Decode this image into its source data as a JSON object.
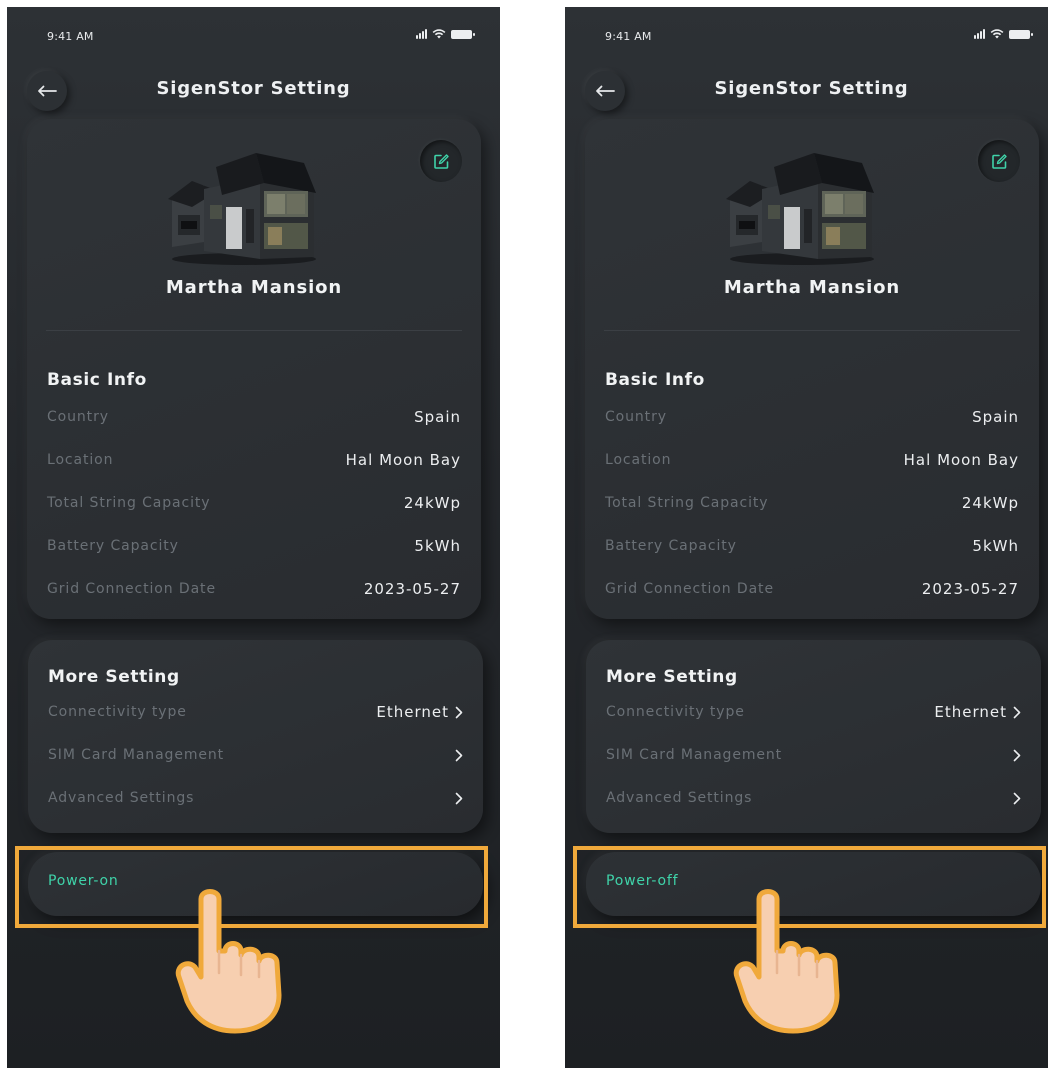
{
  "colors": {
    "accent_teal": "#3fd3a9",
    "highlight_orange": "#f0a93b",
    "background": "#26292d",
    "hand_skin": "#f7cfb0"
  },
  "screens": [
    {
      "status_time": "9:41 AM",
      "header_title": "SigenStor Setting",
      "site_name": "Martha Mansion",
      "basic_info": {
        "title": "Basic Info",
        "rows": [
          {
            "label": "Country",
            "value": "Spain"
          },
          {
            "label": "Location",
            "value": "Hal Moon Bay"
          },
          {
            "label": "Total String Capacity",
            "value": "24kWp"
          },
          {
            "label": "Battery Capacity",
            "value": "5kWh"
          },
          {
            "label": "Grid Connection Date",
            "value": "2023-05-27"
          }
        ]
      },
      "more_setting": {
        "title": "More Setting",
        "rows": [
          {
            "label": "Connectivity type",
            "value": "Ethernet"
          },
          {
            "label": "SIM Card Management",
            "value": ""
          },
          {
            "label": "Advanced Settings",
            "value": ""
          }
        ]
      },
      "power_button": "Power-on"
    },
    {
      "status_time": "9:41 AM",
      "header_title": "SigenStor Setting",
      "site_name": "Martha Mansion",
      "basic_info": {
        "title": "Basic Info",
        "rows": [
          {
            "label": "Country",
            "value": "Spain"
          },
          {
            "label": "Location",
            "value": "Hal Moon Bay"
          },
          {
            "label": "Total String Capacity",
            "value": "24kWp"
          },
          {
            "label": "Battery Capacity",
            "value": "5kWh"
          },
          {
            "label": "Grid Connection Date",
            "value": "2023-05-27"
          }
        ]
      },
      "more_setting": {
        "title": "More Setting",
        "rows": [
          {
            "label": "Connectivity type",
            "value": "Ethernet"
          },
          {
            "label": "SIM Card Management",
            "value": ""
          },
          {
            "label": "Advanced Settings",
            "value": ""
          }
        ]
      },
      "power_button": "Power-off"
    }
  ]
}
